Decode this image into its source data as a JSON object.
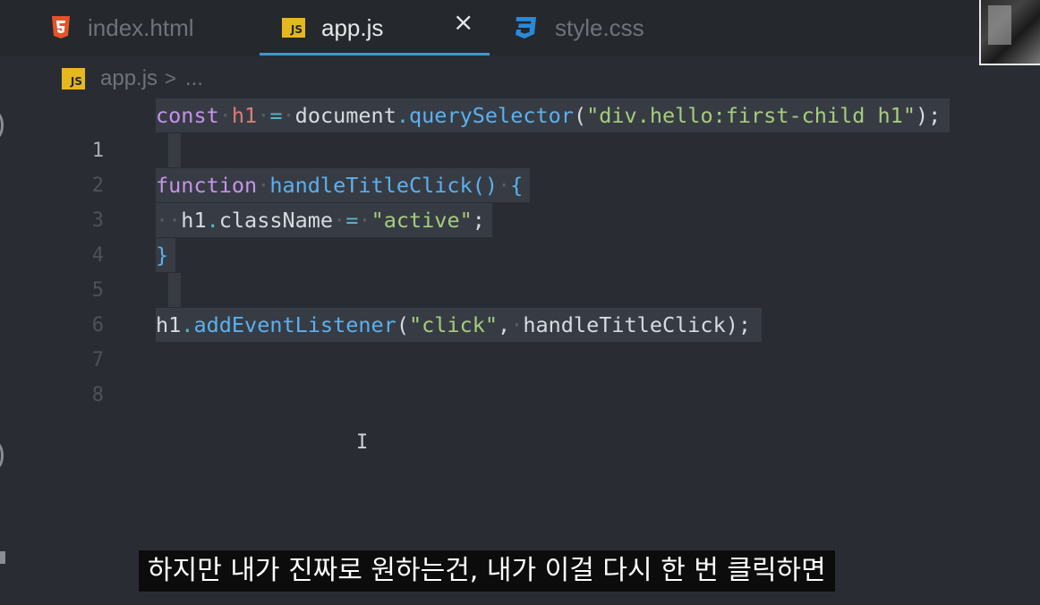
{
  "tabs": [
    {
      "label": "index.html",
      "icon": "html5-icon",
      "active": false
    },
    {
      "label": "app.js",
      "icon": "js-icon",
      "active": true
    },
    {
      "label": "style.css",
      "icon": "css3-icon",
      "active": false
    }
  ],
  "tab_close": "×",
  "js_badge": "JS",
  "breadcrumb": {
    "file": "app.js",
    "sep": ">",
    "more": "..."
  },
  "code": {
    "line_numbers": [
      "1",
      "2",
      "3",
      "4",
      "5",
      "6",
      "7",
      "8"
    ],
    "line1": {
      "kw": "const",
      "var": "h1",
      "op": "=",
      "obj": "document",
      "dot": ".",
      "fn": "querySelector",
      "p1": "(",
      "str": "\"div.hello:first-child h1\"",
      "p2": ");"
    },
    "line3": {
      "kw": "function",
      "fn": "handleTitleClick",
      "paren": "()",
      "brace": "{"
    },
    "line4": {
      "indent": "··",
      "obj": "h1",
      "dot": ".",
      "prop": "className",
      "op": "=",
      "str": "\"active\"",
      "semi": ";"
    },
    "line5": {
      "brace": "}"
    },
    "line7": {
      "obj": "h1",
      "dot": ".",
      "fn": "addEventListener",
      "p1": "(",
      "str": "\"click\"",
      "comma": ",",
      "arg": "handleTitleClick",
      "p2": ");"
    }
  },
  "subtitle": "하지만 내가 진짜로 원하는건, 내가 이걸 다시 한 번 클릭하면",
  "colors": {
    "background": "#292d33",
    "keyword": "#c692ea",
    "function": "#5cb0ef",
    "string": "#a7cc7e",
    "variable": "#e07a78",
    "tab_underline": "#3f97c9"
  }
}
